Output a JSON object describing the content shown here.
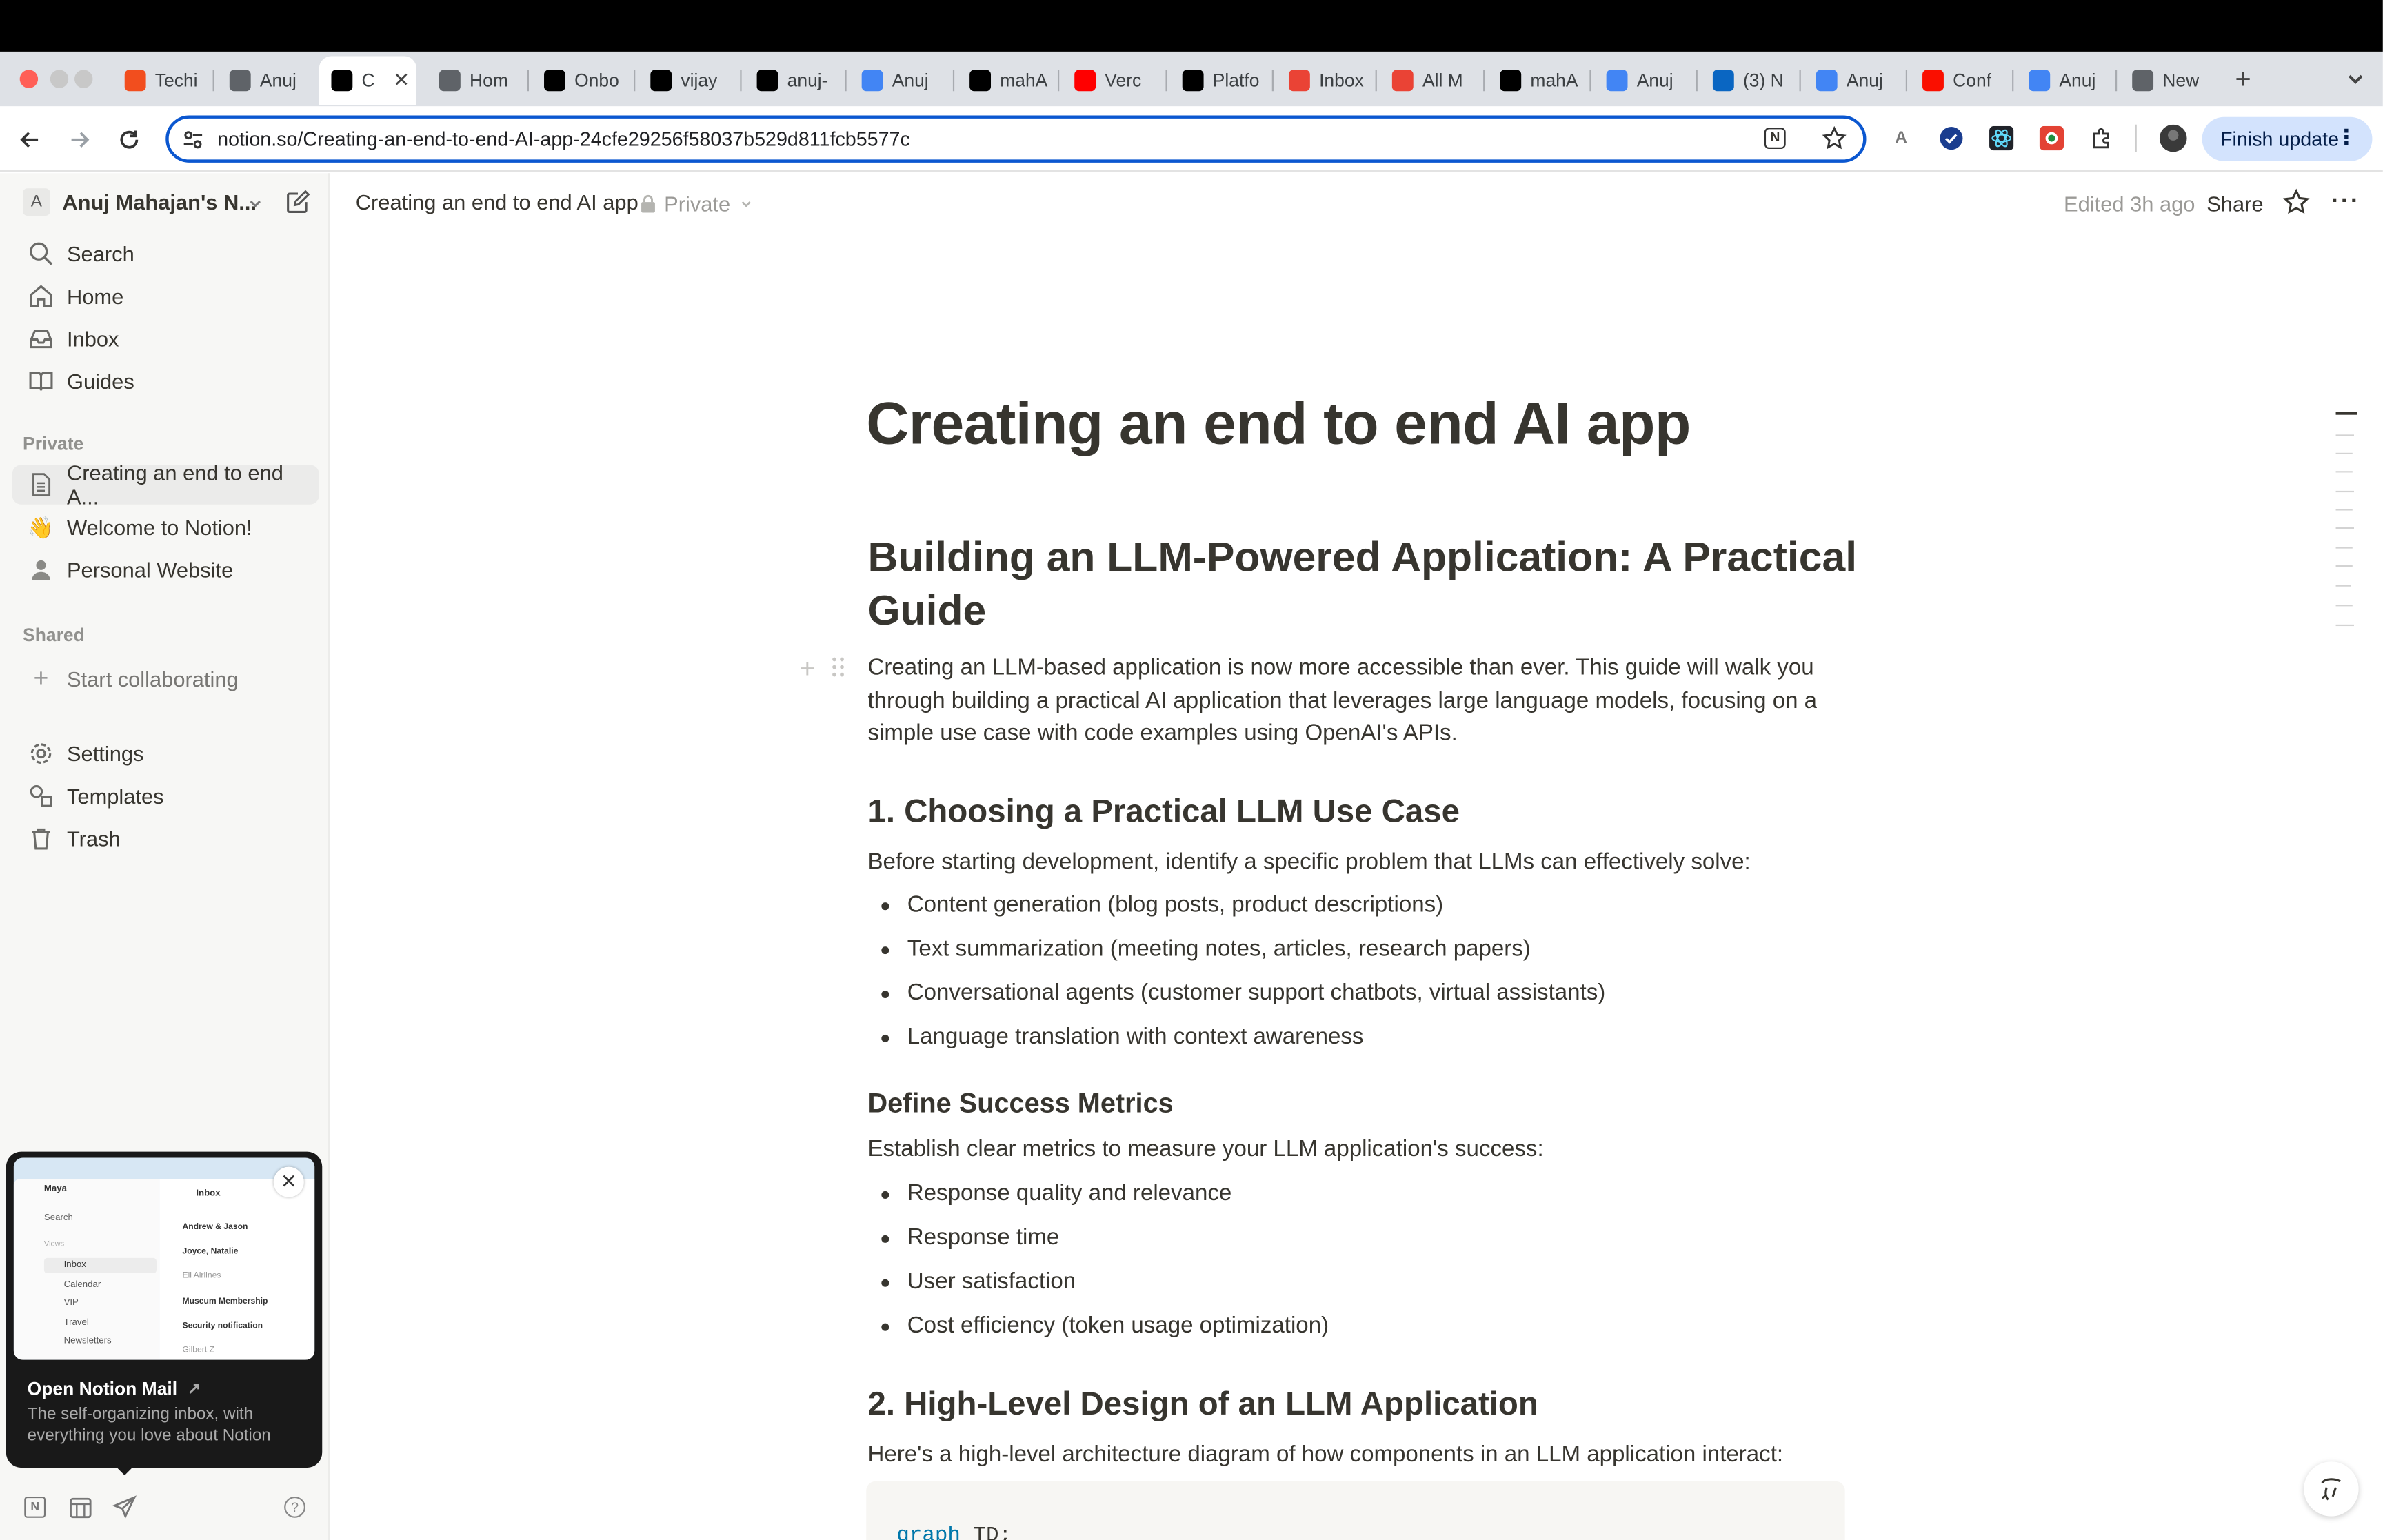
{
  "browser": {
    "tabs": [
      {
        "label": "Techi",
        "icon": "figma-icon",
        "color": "#f24e1e"
      },
      {
        "label": "Anuj",
        "icon": "globe-icon",
        "color": "#5f6368"
      },
      {
        "label": "C",
        "icon": "notion-icon",
        "color": "#000000",
        "active": true
      },
      {
        "label": "Hom",
        "icon": "home-icon",
        "color": "#5f6368"
      },
      {
        "label": "Onbo",
        "icon": "notion-icon",
        "color": "#000000"
      },
      {
        "label": "vijay",
        "icon": "vercel-icon",
        "color": "#000000"
      },
      {
        "label": "anuj-",
        "icon": "vercel-icon",
        "color": "#000000"
      },
      {
        "label": "Anuj",
        "icon": "am-icon",
        "color": "#4285f4"
      },
      {
        "label": "mahA",
        "icon": "github-icon",
        "color": "#000000"
      },
      {
        "label": "Verc",
        "icon": "youtube-icon",
        "color": "#ff0000"
      },
      {
        "label": "Platfo",
        "icon": "openai-icon",
        "color": "#000000"
      },
      {
        "label": "Inbox",
        "icon": "gmail-icon",
        "color": "#ea4335"
      },
      {
        "label": "All M",
        "icon": "gmail-icon",
        "color": "#ea4335"
      },
      {
        "label": "mahA",
        "icon": "github-icon",
        "color": "#000000"
      },
      {
        "label": "Anuj",
        "icon": "am-icon",
        "color": "#4285f4"
      },
      {
        "label": "(3) N",
        "icon": "linkedin-icon",
        "color": "#0a66c2"
      },
      {
        "label": "Anuj",
        "icon": "am-icon",
        "color": "#4285f4"
      },
      {
        "label": "Conf",
        "icon": "adobe-icon",
        "color": "#fa0f00"
      },
      {
        "label": "Anuj",
        "icon": "am-icon",
        "color": "#4285f4"
      },
      {
        "label": "New",
        "icon": "chrome-icon",
        "color": "#5f6368"
      }
    ],
    "url": "notion.so/Creating-an-end-to-end-AI-app-24cfe29256f58037b529d811fcb5577c",
    "finish_update": "Finish update"
  },
  "sidebar": {
    "workspace_initial": "A",
    "workspace_name": "Anuj Mahajan's N...",
    "nav": [
      "Search",
      "Home",
      "Inbox",
      "Guides"
    ],
    "private_heading": "Private",
    "private_pages": [
      "Creating an end to end A...",
      "Welcome to Notion!",
      "Personal Website"
    ],
    "shared_heading": "Shared",
    "start_collaborating": "Start collaborating",
    "bottom": [
      "Settings",
      "Templates",
      "Trash"
    ],
    "popup": {
      "title": "Open Notion Mail",
      "desc": "The self-organizing inbox, with everything you love about Notion",
      "preview": {
        "user": "Maya",
        "search": "Search",
        "views": "Views",
        "items": [
          "Inbox",
          "Calendar",
          "VIP",
          "Travel",
          "Newsletters"
        ],
        "inbox_title": "Inbox",
        "mails": [
          "Andrew & Jason",
          "Joyce, Natalie",
          "Eli Airlines",
          "Museum Membership",
          "Security notification",
          "Gilbert Z"
        ]
      }
    }
  },
  "header": {
    "breadcrumb": "Creating an end to end AI app",
    "privacy": "Private",
    "edited": "Edited 3h ago",
    "share": "Share"
  },
  "doc": {
    "title": "Creating an end to end AI app",
    "h2_main_line1": "Building an LLM-Powered Application: A Practical",
    "h2_main_line2": "Guide",
    "intro_line1": "Creating an LLM-based application is now more accessible than ever. This guide will walk you",
    "intro_line2": "through building a practical AI application that leverages large language models, focusing on a",
    "intro_line3": "simple use case with code examples using OpenAI's APIs.",
    "s1_heading": "1. Choosing a Practical LLM Use Case",
    "s1_para": "Before starting development, identify a specific problem that LLMs can effectively solve:",
    "s1_bullets": [
      "Content generation (blog posts, product descriptions)",
      "Text summarization (meeting notes, articles, research papers)",
      "Conversational agents (customer support chatbots, virtual assistants)",
      "Language translation with context awareness"
    ],
    "metrics_heading": "Define Success Metrics",
    "metrics_para": "Establish clear metrics to measure your LLM application's success:",
    "metrics_bullets": [
      "Response quality and relevance",
      "Response time",
      "User satisfaction",
      "Cost efficiency (token usage optimization)"
    ],
    "s2_heading": "2. High-Level Design of an LLM Application",
    "s2_para": "Here's a high-level architecture diagram of how components in an LLM application interact:",
    "code_kw": "graph",
    "code_rest": " TD;"
  }
}
